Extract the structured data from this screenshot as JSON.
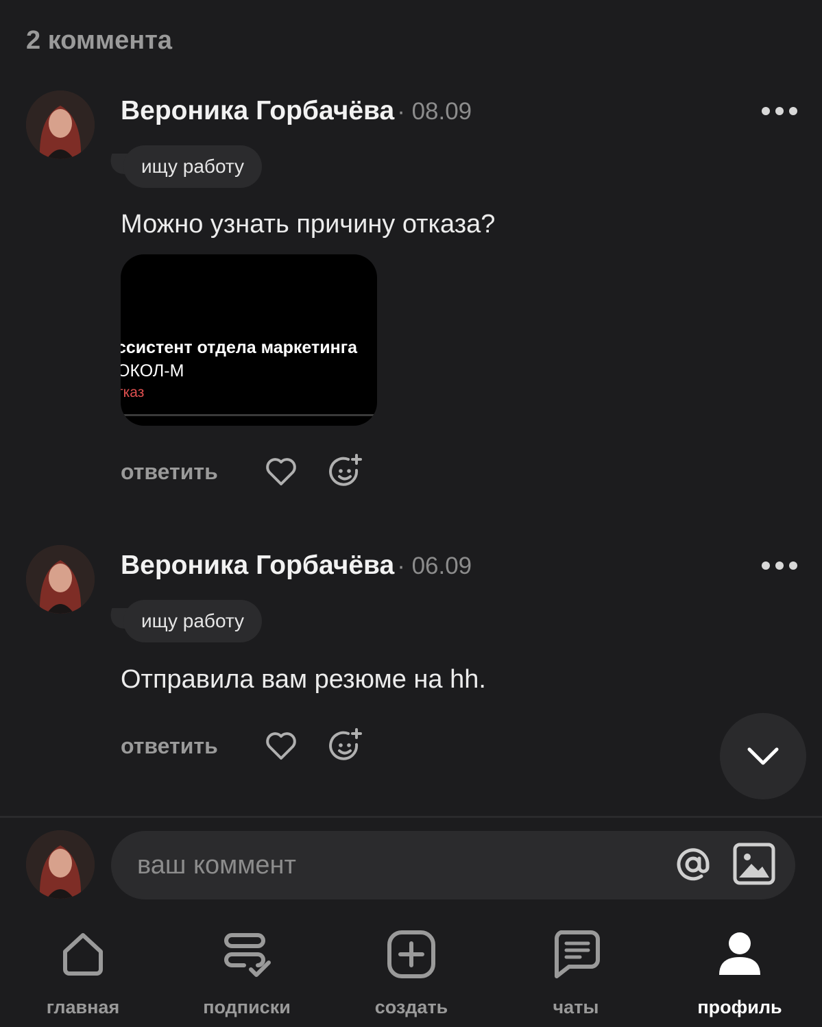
{
  "header": {
    "count_label": "2 коммента"
  },
  "comments": [
    {
      "author": "Вероника Горбачёва",
      "date": "· 08.09",
      "tag": "ищу работу",
      "text": "Можно узнать причину отказа?",
      "attachment": {
        "line1": "ссистент отдела маркетинга",
        "line2": "ОКОЛ-М",
        "line3": "тказ"
      },
      "reply_label": "ответить"
    },
    {
      "author": "Вероника Горбачёва",
      "date": "· 06.09",
      "tag": "ищу работу",
      "text": "Отправила вам резюме на hh.",
      "reply_label": "ответить"
    }
  ],
  "composer": {
    "placeholder": "ваш коммент"
  },
  "nav": {
    "items": [
      {
        "label": "главная",
        "icon": "home-icon"
      },
      {
        "label": "подписки",
        "icon": "subscriptions-icon"
      },
      {
        "label": "создать",
        "icon": "create-plus-icon"
      },
      {
        "label": "чаты",
        "icon": "chat-icon"
      },
      {
        "label": "профиль",
        "icon": "profile-icon",
        "active": true
      }
    ]
  },
  "colors": {
    "background": "#1c1c1e",
    "surface": "#2b2b2d",
    "muted": "#9a9a9a",
    "reject_red": "#e05050"
  }
}
